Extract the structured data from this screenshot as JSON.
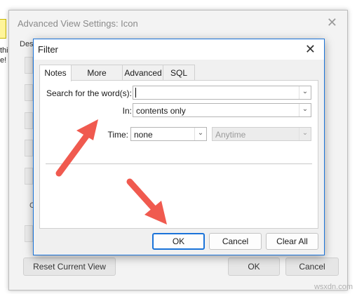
{
  "background": {
    "text1": "thi",
    "text2": "e!"
  },
  "outer_dialog": {
    "title": "Advanced View Settings: Icon",
    "desc_label": "Des",
    "c_label": "C",
    "reset_button": "Reset Current View",
    "ok_button": "OK",
    "cancel_button": "Cancel"
  },
  "filter_dialog": {
    "title": "Filter",
    "tabs": [
      {
        "label": "Notes",
        "active": true
      },
      {
        "label": "More Choices",
        "active": false
      },
      {
        "label": "Advanced",
        "active": false
      },
      {
        "label": "SQL",
        "active": false
      }
    ],
    "search_label": "Search for the word(s):",
    "search_value": "",
    "in_label": "In:",
    "in_value": "contents only",
    "time_label": "Time:",
    "time_value": "none",
    "time_range_value": "Anytime",
    "buttons": {
      "ok": "OK",
      "cancel": "Cancel",
      "clear_all": "Clear All"
    }
  },
  "colors": {
    "accent": "#1a73d9",
    "arrow": "#f05a4f"
  },
  "watermark": "wsxdn.com"
}
